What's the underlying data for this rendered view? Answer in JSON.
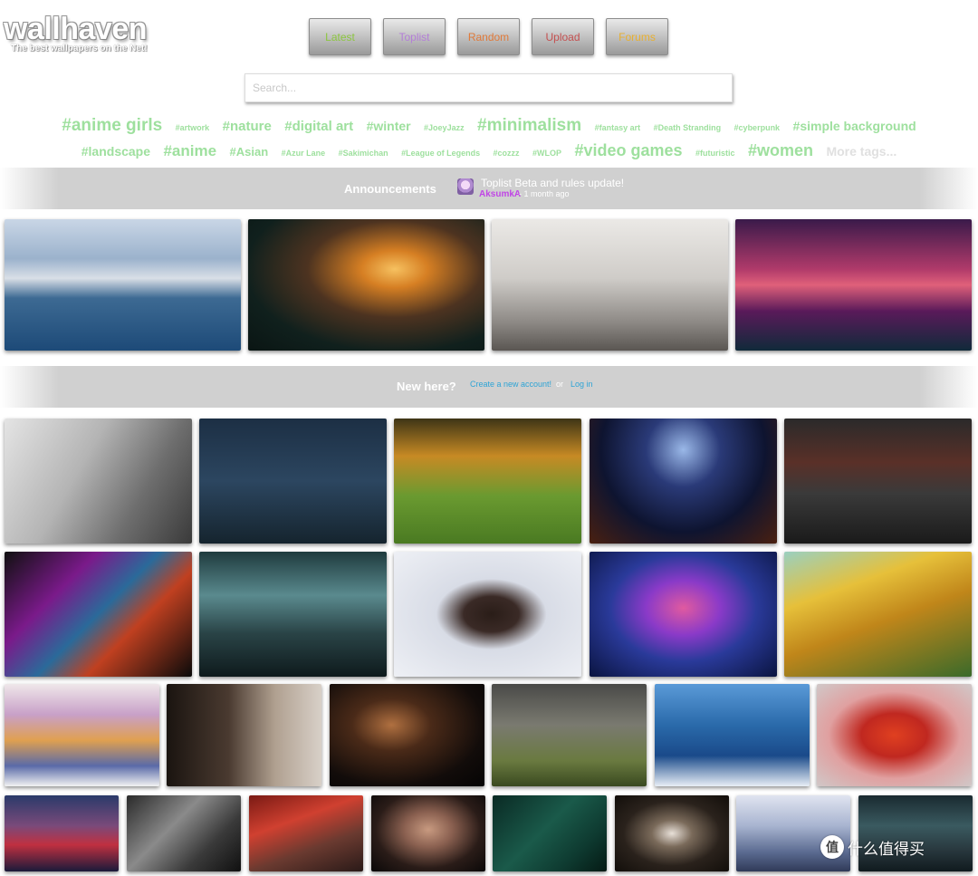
{
  "logo": {
    "name": "wallhaven",
    "tagline": "The best wallpapers on the Net!"
  },
  "nav": [
    {
      "label": "Latest",
      "color": "#8cc63f"
    },
    {
      "label": "Toplist",
      "color": "#b47ed8"
    },
    {
      "label": "Random",
      "color": "#e07a3a"
    },
    {
      "label": "Upload",
      "color": "#c45050"
    },
    {
      "label": "Forums",
      "color": "#e8b030"
    }
  ],
  "search": {
    "placeholder": "Search..."
  },
  "tags": [
    [
      "#anime girls",
      "#artwork",
      "#nature",
      "#digital art",
      "#winter",
      "#JoeyJazz",
      "#minimalism",
      "#fantasy art",
      "#Death Stranding",
      "#cyberpunk",
      "#simple background"
    ],
    [
      "#landscape",
      "#anime",
      "#Asian",
      "#Azur Lane",
      "#Sakimichan",
      "#League of Legends",
      "#cozzz",
      "#WLOP",
      "#video games",
      "#futuristic",
      "#women",
      "More tags..."
    ]
  ],
  "announcements": {
    "heading": "Announcements",
    "title": "Toplist Beta and rules update!",
    "user": "AksumkA",
    "time": "- 1 month ago"
  },
  "newhere": {
    "heading": "New here?",
    "create_link": "Create a new account!",
    "or_text": "or",
    "login_link": "Log in"
  },
  "watermark": {
    "icon": "值",
    "text": "什么值得买"
  }
}
